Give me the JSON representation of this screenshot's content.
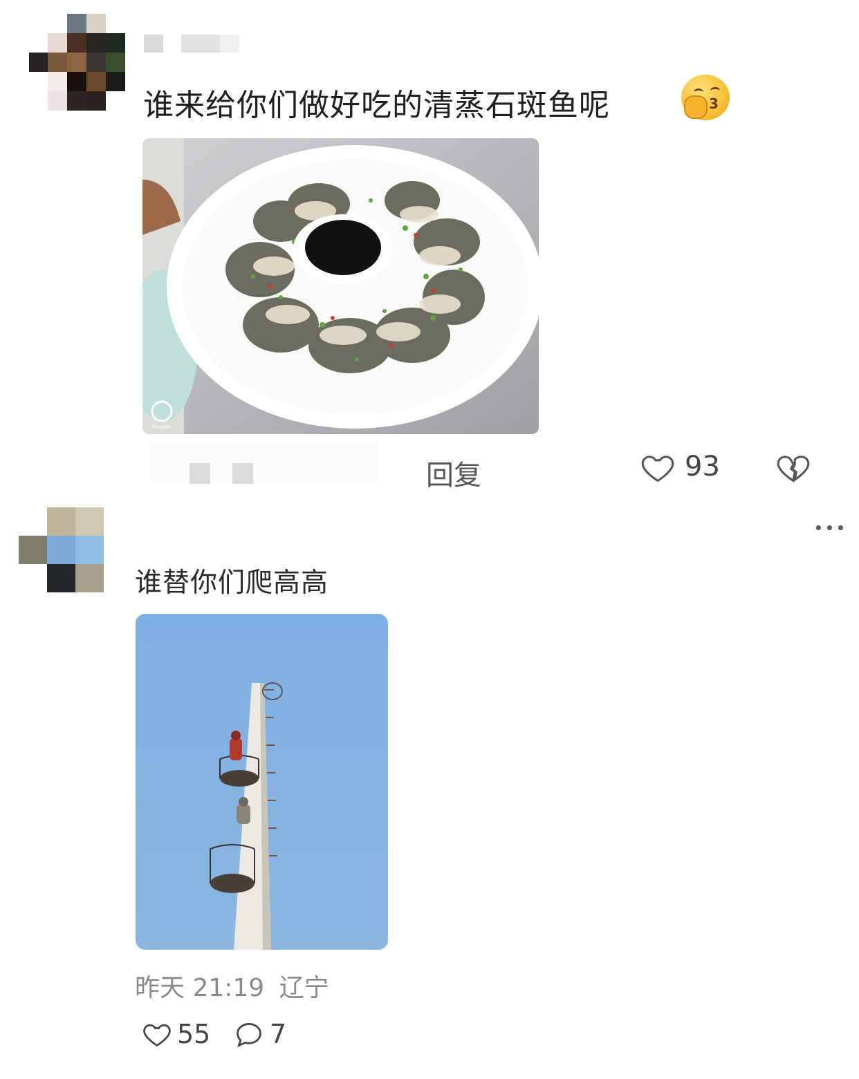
{
  "comment1": {
    "text": "谁来给你们做好吃的清蒸石斑鱼呢",
    "emoji": "shushing-face-emoji",
    "image": "steamed-grouper-plate-photo",
    "image_watermark": "Foodie",
    "reply_label": "回复",
    "like_count": "93",
    "icons": {
      "like": "heart-outline-icon",
      "dislike": "broken-heart-icon"
    }
  },
  "comment2": {
    "text": "谁替你们爬高高",
    "image": "worker-climbing-tower-photo",
    "timestamp": "昨天 21:19",
    "location": "辽宁",
    "like_count": "55",
    "reply_count": "7",
    "icons": {
      "more": "more-dots-icon",
      "like": "heart-outline-icon",
      "comment": "comment-bubble-icon"
    }
  },
  "colors": {
    "text_primary": "#1f1f1f",
    "text_secondary": "#8a8a8a",
    "icon_gray": "#555555",
    "sky_blue": "#80aee0"
  }
}
